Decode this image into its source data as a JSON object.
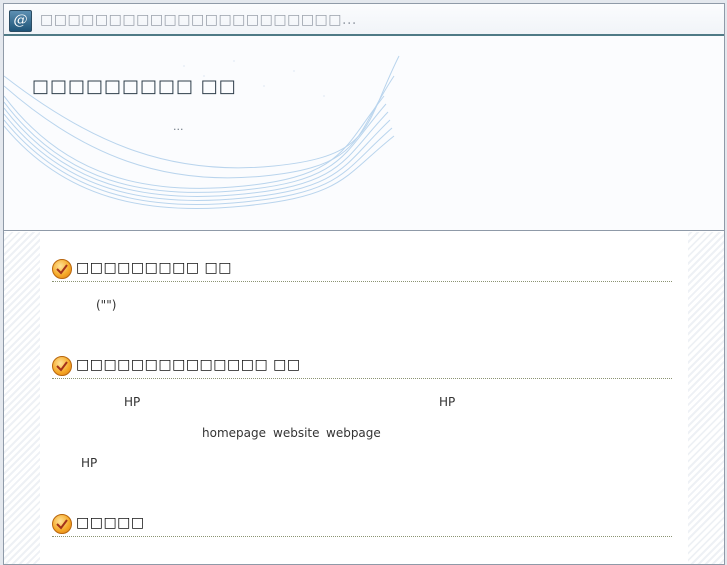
{
  "window": {
    "icon": "at-sign-icon",
    "title": "□□□□□□□□□□□□□□□□□□□□□□..."
  },
  "banner": {
    "title": "□□□□□□□□□ □□",
    "subtitle": "..."
  },
  "sections": [
    {
      "icon": "checkmark-icon",
      "title": "□□□□□□□□□ □□",
      "lines": [
        "(\"\")"
      ]
    },
    {
      "icon": "checkmark-icon",
      "title": "□□□□□□□□□□□□□□ □□",
      "lines": [
        "HP",
        "HP",
        "homepage",
        "website",
        "webpage",
        "HP"
      ]
    },
    {
      "icon": "checkmark-icon",
      "title": "□□□□□",
      "lines": []
    }
  ],
  "colors": {
    "accent": "#4f7a86",
    "check_orange": "#f5a623",
    "banner_wave": "#9fc4e6"
  }
}
